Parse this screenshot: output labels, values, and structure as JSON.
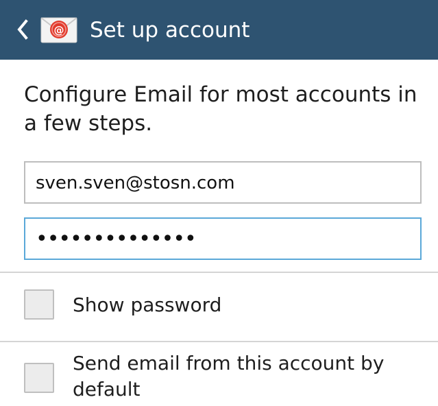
{
  "header": {
    "title": "Set up account",
    "back_icon": "chevron-left-icon",
    "app_icon": "email-app-icon",
    "background_color": "#2e5371"
  },
  "intro_text": "Configure Email for most accounts in a few steps.",
  "form": {
    "email_value": "sven.sven@stosn.com",
    "password_value": "••••••••••••••",
    "focused_border_color": "#5aa8d8"
  },
  "options": [
    {
      "label": "Show password",
      "checked": false
    },
    {
      "label": "Send email from this account by default",
      "checked": false
    }
  ]
}
